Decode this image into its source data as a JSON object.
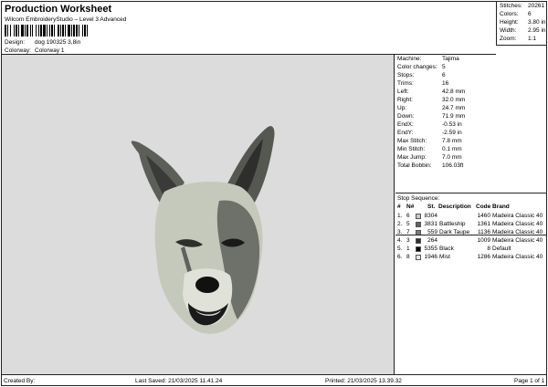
{
  "header": {
    "title": "Production Worksheet",
    "subtitle": "Wilcom EmbroideryStudio – Level 3 Advanced",
    "design_label": "Design:",
    "design_value": "dog 190325 3,8in",
    "colorway_label": "Colorway:",
    "colorway_value": "Colorway 1"
  },
  "stats": {
    "stitches_label": "Stitches:",
    "stitches": "20261",
    "colors_label": "Colors:",
    "colors": "6",
    "height_label": "Height:",
    "height": "3.80 in",
    "width_label": "Width:",
    "width": "2.95 in",
    "zoom_label": "Zoom:",
    "zoom": "1:1"
  },
  "machine_info": {
    "machine_label": "Machine:",
    "machine": "Tajima",
    "color_changes_label": "Color changes:",
    "color_changes": "5",
    "stops_label": "Stops:",
    "stops": "6",
    "trims_label": "Trims:",
    "trims": "16",
    "left_label": "Left:",
    "left": "42.8 mm",
    "right_label": "Right:",
    "right": "32.0 mm",
    "up_label": "Up:",
    "up": "24.7 mm",
    "down_label": "Down:",
    "down": "71.9 mm",
    "endx_label": "EndX:",
    "endx": "-0.53 in",
    "endy_label": "EndY:",
    "endy": "-2.59 in",
    "max_stitch_label": "Max Stitch:",
    "max_stitch": "7.8 mm",
    "min_stitch_label": "Min Stitch:",
    "min_stitch": "0.1 mm",
    "max_jump_label": "Max Jump:",
    "max_jump": "7.0 mm",
    "total_bobbin_label": "Total Bobbin:",
    "total_bobbin": "106.03ft"
  },
  "stop_sequence": {
    "title": "Stop Sequence:",
    "columns": [
      "#",
      "N#",
      "St.",
      "Description",
      "Code",
      "Brand"
    ],
    "rows": [
      {
        "n": "1.",
        "nn": "6",
        "st": "8304",
        "desc": "",
        "code": "1460",
        "brand": "Madeira Classic 40",
        "color": "#c9cdbf"
      },
      {
        "n": "2.",
        "nn": "5",
        "st": "3831",
        "desc": "Battleship",
        "code": "1361",
        "brand": "Madeira Classic 40",
        "color": "#5f615e"
      },
      {
        "n": "3.",
        "nn": "7",
        "st": "559",
        "desc": "Dark Taupe",
        "code": "1136",
        "brand": "Madeira Classic 40",
        "color": "#7d7a72"
      },
      {
        "n": "4.",
        "nn": "3",
        "st": "264",
        "desc": "",
        "code": "1009",
        "brand": "Madeira Classic 40",
        "color": "#2e2e2e"
      },
      {
        "n": "5.",
        "nn": "1",
        "st": "5355",
        "desc": "Black",
        "code": "8",
        "brand": "Default",
        "color": "#000000"
      },
      {
        "n": "6.",
        "nn": "8",
        "st": "1946",
        "desc": "Mist",
        "code": "1286",
        "brand": "Madeira Classic 40",
        "color": "#e7e9e1"
      }
    ]
  },
  "footer": {
    "created_by": "Created By:",
    "last_saved": "Last Saved: 21/03/2025 11.41.24",
    "printed": "Printed: 21/03/2025 13.39.32",
    "page": "Page 1 of 1"
  }
}
